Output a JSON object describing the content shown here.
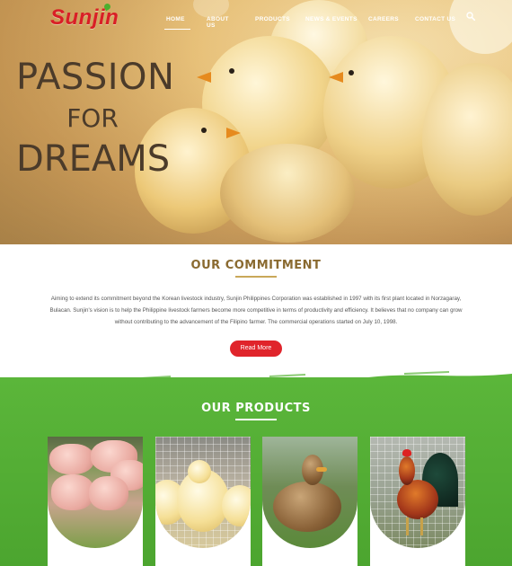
{
  "brand": {
    "logo_text": "Sunjin",
    "accent": "#d91f26",
    "green": "#4caf2e"
  },
  "nav": {
    "items": [
      "HOME",
      "ABOUT US",
      "PRODUCTS",
      "NEWS & EVENTS",
      "CAREERS",
      "CONTACT US"
    ],
    "active": "HOME",
    "search_icon": "search-icon"
  },
  "hero": {
    "line1": "PASSION",
    "line2": "FOR",
    "line3": "DREAMS"
  },
  "commitment": {
    "title": "OUR COMMITMENT",
    "text": "Aiming to extend its commitment beyond the Korean livestock industry, Sunjin Philippines Corporation was established in 1997 with its first plant located in Norzagaray, Bulacan. Sunjin's vision is to help the Philippine livestock farmers become more competitive in terms of productivity and efficiency. It believes that no company can grow without contributing to the advancement of the Filipino farmer. The commercial operations started on July 10, 1998.",
    "button": "Read More",
    "button_color": "#e0242b"
  },
  "products": {
    "title": "OUR PRODUCTS",
    "background": "#4ca52f",
    "cards": [
      "pigs",
      "chicks",
      "duck",
      "rooster"
    ]
  }
}
